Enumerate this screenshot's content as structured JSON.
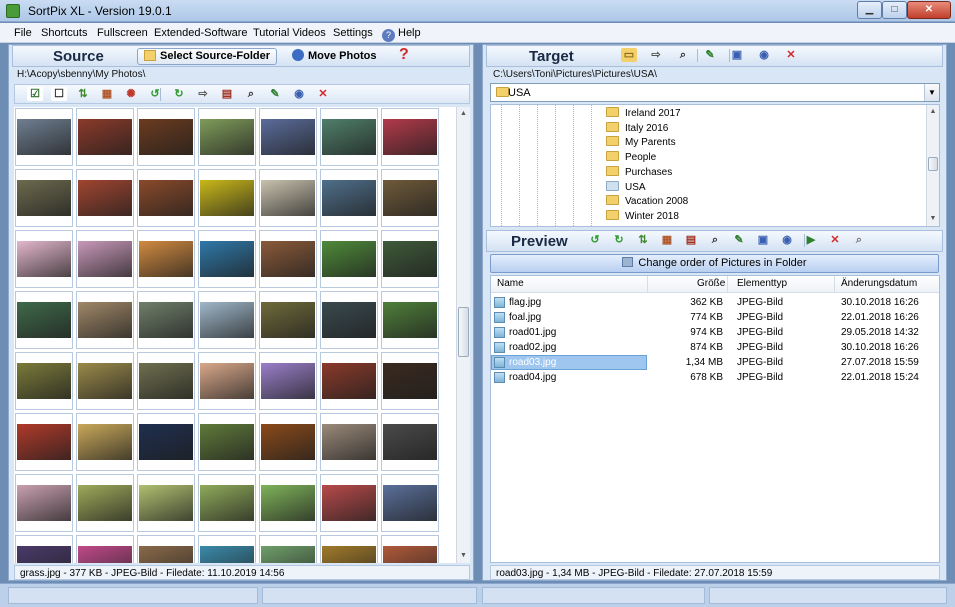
{
  "window": {
    "title": "SortPix XL - Version 19.0.1"
  },
  "menu": [
    "File",
    "Shortcuts",
    "Fullscreen",
    "Extended-Software",
    "Tutorial Videos",
    "Settings",
    "Help"
  ],
  "source": {
    "title": "Source",
    "select_folder_label": "Select Source-Folder",
    "move_photos_label": "Move Photos",
    "help_label": "?",
    "path": "H:\\Acopy\\sbenny\\My Photos\\",
    "status": "grass.jpg - 377 KB - JPEG-Bild - Filedate: 11.10.2019 14:56",
    "toolbar_icons": [
      "select-all-icon",
      "deselect-icon",
      "sort-icon",
      "grid-view-icon",
      "color-wheel-icon",
      "rotate-left-icon",
      "rotate-right-icon",
      "move-icon",
      "copy-icon",
      "zoom-icon",
      "edit-icon",
      "web-icon",
      "delete-icon"
    ],
    "thumbnail_colors": [
      [
        "#6f7f91",
        "#8b3a2a",
        "#6b3b1f",
        "#7f9c5a",
        "#5a6c9a",
        "#4f7f6a",
        "#b23a4a"
      ],
      [
        "#6d6a4e",
        "#a04530",
        "#8a4a2a",
        "#c9b81a",
        "#c9c2ae",
        "#4f6f8a",
        "#6f5a3a"
      ],
      [
        "#e3b7cc",
        "#c898b9",
        "#d18a40",
        "#2f78a8",
        "#8a5a3a",
        "#4f8a3a",
        "#3f5a3a"
      ],
      [
        "#3f6a4a",
        "#a08868",
        "#6f7f6a",
        "#9fb7c9",
        "#6f6a3a",
        "#3a4a4f",
        "#4f7f3a"
      ],
      [
        "#7a7a3a",
        "#9a8a4a",
        "#6f6f4f",
        "#d9a88a",
        "#9a7fc9",
        "#8a3a2a",
        "#3a2a1f"
      ],
      [
        "#b03a2a",
        "#c9a85a",
        "#1f2f4f",
        "#5f7a3a",
        "#8a4a1a",
        "#9a8a7a",
        "#4a4a4a"
      ],
      [
        "#c9a0b0",
        "#9faa5a",
        "#b0c070",
        "#8faa5a",
        "#7fb35a",
        "#b84a4a",
        "#5a6f9a"
      ],
      [
        "#4a3a6a",
        "#c04a8a",
        "#8a6a4a",
        "#3a8aa8",
        "#6f9f6a",
        "#a07a2a",
        "#b05a3a"
      ]
    ]
  },
  "target": {
    "title": "Target",
    "path": "C:\\Users\\Toni\\Pictures\\Pictures\\USA\\",
    "current_folder": "USA",
    "toolbar_icons": [
      "new-folder-icon",
      "move-icon",
      "zoom-icon",
      "edit-icon",
      "screen-icon",
      "web-icon",
      "delete-icon"
    ],
    "folders": [
      "Ireland 2017",
      "Italy 2016",
      "My Parents",
      "People",
      "Purchases",
      "USA",
      "Vacation 2008",
      "Winter 2018"
    ],
    "selected_folder": "USA"
  },
  "preview": {
    "title": "Preview",
    "change_order_label": "Change order of Pictures in Folder",
    "columns": {
      "name": "Name",
      "size": "Größe",
      "type": "Elementtyp",
      "date": "Änderungsdatum"
    },
    "files": [
      {
        "name": "flag.jpg",
        "size": "362 KB",
        "type": "JPEG-Bild",
        "date": "30.10.2018 16:26"
      },
      {
        "name": "foal.jpg",
        "size": "774 KB",
        "type": "JPEG-Bild",
        "date": "22.01.2018 16:26"
      },
      {
        "name": "road01.jpg",
        "size": "974 KB",
        "type": "JPEG-Bild",
        "date": "29.05.2018 14:32"
      },
      {
        "name": "road02.jpg",
        "size": "874 KB",
        "type": "JPEG-Bild",
        "date": "30.10.2018 16:26"
      },
      {
        "name": "road03.jpg",
        "size": "1,34 MB",
        "type": "JPEG-Bild",
        "date": "27.07.2018 15:59"
      },
      {
        "name": "road04.jpg",
        "size": "678 KB",
        "type": "JPEG-Bild",
        "date": "22.01.2018 15:24"
      }
    ],
    "selected_file": "road03.jpg",
    "status": "road03.jpg - 1,34 MB - JPEG-Bild - Filedate: 27.07.2018 15:59",
    "toolbar_icons": [
      "rotate-left-icon",
      "rotate-right-icon",
      "sort-icon",
      "grid-view-icon",
      "copy-icon",
      "zoom-icon",
      "edit-icon",
      "screen-icon",
      "web-icon",
      "slideshow-icon",
      "delete-icon",
      "search-icon"
    ]
  },
  "colors": {
    "accent": "#5d7cc0",
    "panel": "#d9e6f5",
    "selection": "#9ec6ee",
    "delete": "#d22a2a"
  }
}
